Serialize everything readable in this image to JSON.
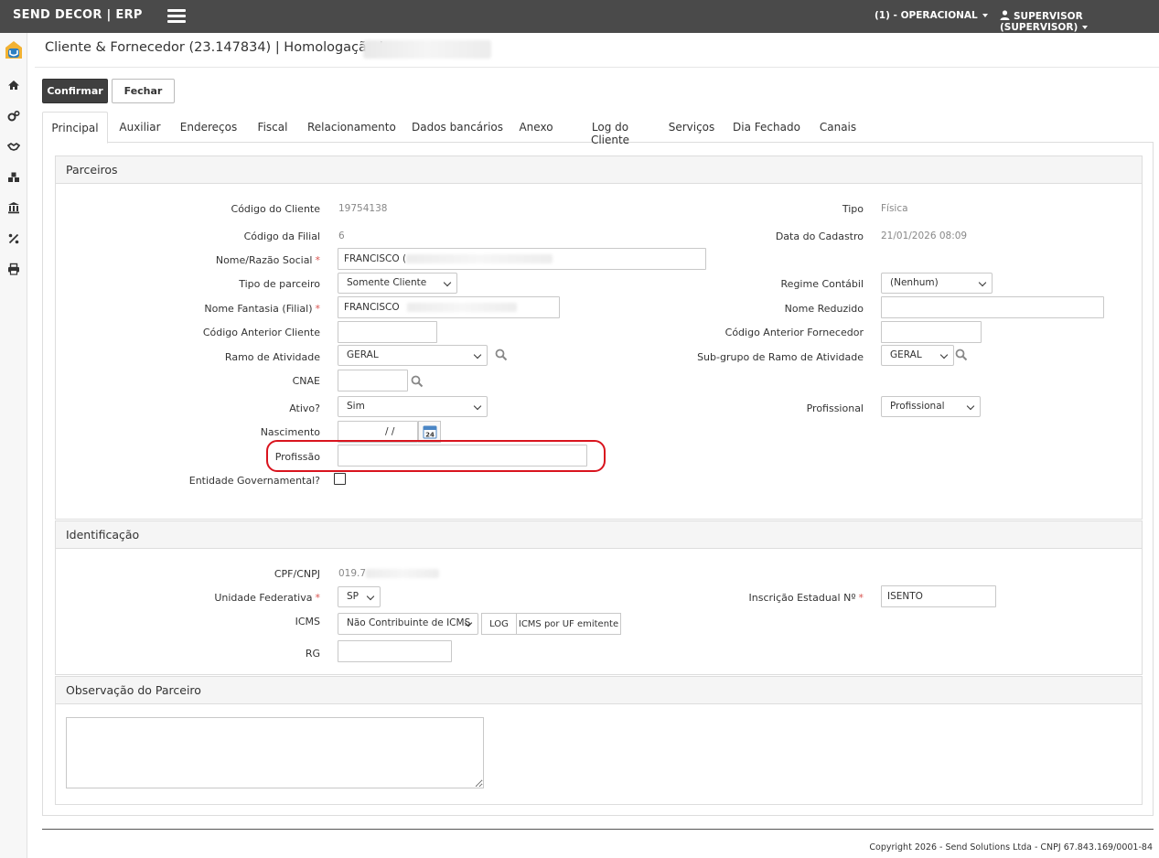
{
  "header": {
    "brand": "SEND DECOR | ERP",
    "company_menu": "(1) - OPERACIONAL",
    "user_menu": "SUPERVISOR (SUPERVISOR)"
  },
  "sidebar": {
    "icons": [
      "logo-icon",
      "home-icon",
      "gears-icon",
      "handshake-icon",
      "cubes-icon",
      "bank-icon",
      "percent-icon",
      "print-icon"
    ]
  },
  "page": {
    "title": "Cliente & Fornecedor (23.147834)",
    "env": "| Homologação |"
  },
  "toolbar": {
    "confirm_label": "Confirmar",
    "close_label": "Fechar"
  },
  "tabs": [
    "Principal",
    "Auxiliar",
    "Endereços",
    "Fiscal",
    "Relacionamento",
    "Dados bancários",
    "Anexo",
    "Log do Cliente",
    "Serviços",
    "Dia Fechado",
    "Canais"
  ],
  "parceiros": {
    "heading": "Parceiros",
    "codigo_cliente_label": "Código do Cliente",
    "codigo_cliente": "19754138",
    "tipo_label": "Tipo",
    "tipo": "Física",
    "codigo_filial_label": "Código da Filial",
    "codigo_filial": "6",
    "data_cadastro_label": "Data do Cadastro",
    "data_cadastro": "21/01/2026 08:09",
    "nome_label": "Nome/Razão Social",
    "nome": "FRANCISCO (",
    "tipo_parceiro_label": "Tipo de parceiro",
    "tipo_parceiro": "Somente Cliente",
    "regime_label": "Regime Contábil",
    "regime": "(Nenhum)",
    "fantasia_label": "Nome Fantasia (Filial)",
    "fantasia": "FRANCISCO",
    "reduzido_label": "Nome Reduzido",
    "cod_ant_cliente_label": "Código Anterior Cliente",
    "cod_ant_fornecedor_label": "Código Anterior Fornecedor",
    "ramo_label": "Ramo de Atividade",
    "ramo": "GERAL",
    "subgrupo_label": "Sub-grupo de Ramo de Atividade",
    "subgrupo": "GERAL",
    "cnae_label": "CNAE",
    "ativo_label": "Ativo?",
    "ativo": "Sim",
    "profissional_label": "Profissional",
    "profissional": "Profissional",
    "nascimento_label": "Nascimento",
    "nascimento": "/ /",
    "calendar_day": "24",
    "profissao_label": "Profissão",
    "entidade_label": "Entidade Governamental?"
  },
  "identificacao": {
    "heading": "Identificação",
    "cpf_label": "CPF/CNPJ",
    "cpf": "019.7",
    "uf_label": "Unidade Federativa",
    "uf": "SP",
    "ie_label": "Inscrição Estadual Nº",
    "ie": "ISENTO",
    "icms_label": "ICMS",
    "icms": "Não Contribuinte de ICMS",
    "log_button": "LOG",
    "icms_uf_button": "ICMS por UF emitente",
    "rg_label": "RG"
  },
  "observacao": {
    "heading": "Observação do Parceiro"
  },
  "footer": {
    "copyright": "Copyright 2026 - Send Solutions Ltda - CNPJ 67.843.169/0001-84"
  }
}
